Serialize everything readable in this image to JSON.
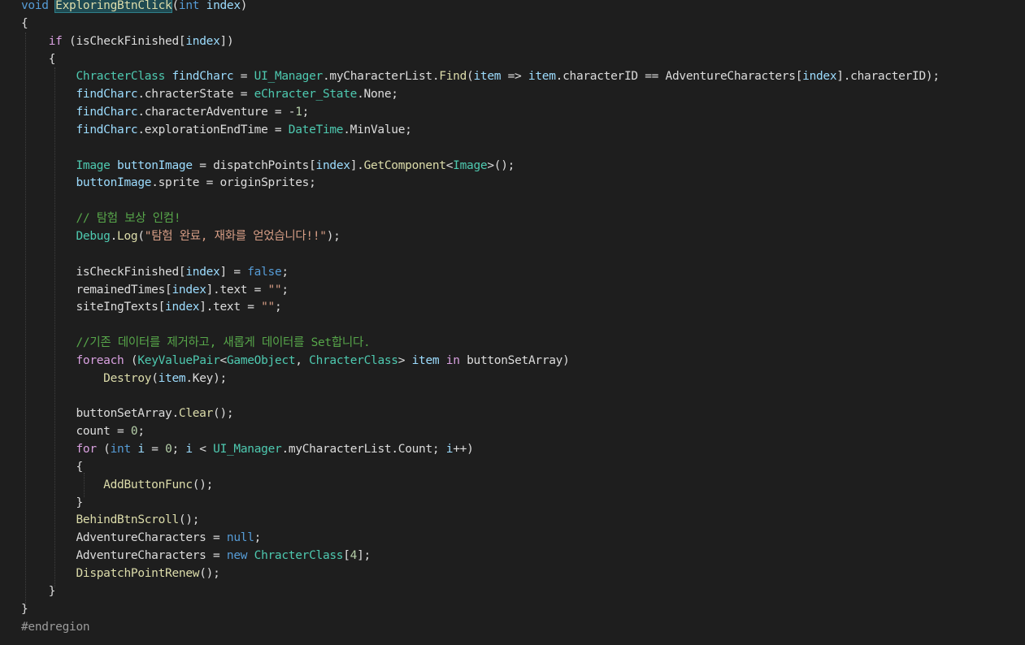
{
  "editor": {
    "lines": [
      [
        {
          "t": "void ",
          "c": "kw"
        },
        {
          "t": "ExploringBtnClick",
          "c": "method hl"
        },
        {
          "t": "(",
          "c": ""
        },
        {
          "t": "int ",
          "c": "kw"
        },
        {
          "t": "index",
          "c": "param"
        },
        {
          "t": ")",
          "c": ""
        }
      ],
      [
        {
          "t": "{",
          "c": ""
        }
      ],
      [
        {
          "t": "    ",
          "c": ""
        },
        {
          "t": "if",
          "c": "ctl"
        },
        {
          "t": " (isCheckFinished[",
          "c": ""
        },
        {
          "t": "index",
          "c": "param"
        },
        {
          "t": "])",
          "c": ""
        }
      ],
      [
        {
          "t": "    {",
          "c": ""
        }
      ],
      [
        {
          "t": "        ",
          "c": ""
        },
        {
          "t": "ChracterClass",
          "c": "type"
        },
        {
          "t": " ",
          "c": ""
        },
        {
          "t": "findCharc",
          "c": "local"
        },
        {
          "t": " = ",
          "c": ""
        },
        {
          "t": "UI_Manager",
          "c": "type"
        },
        {
          "t": ".myCharacterList.",
          "c": ""
        },
        {
          "t": "Find",
          "c": "method"
        },
        {
          "t": "(",
          "c": ""
        },
        {
          "t": "item",
          "c": "local"
        },
        {
          "t": " => ",
          "c": ""
        },
        {
          "t": "item",
          "c": "local"
        },
        {
          "t": ".characterID == AdventureCharacters[",
          "c": ""
        },
        {
          "t": "index",
          "c": "param"
        },
        {
          "t": "].characterID);",
          "c": ""
        }
      ],
      [
        {
          "t": "        ",
          "c": ""
        },
        {
          "t": "findCharc",
          "c": "local"
        },
        {
          "t": ".chracterState = ",
          "c": ""
        },
        {
          "t": "eChracter_State",
          "c": "type"
        },
        {
          "t": ".None;",
          "c": ""
        }
      ],
      [
        {
          "t": "        ",
          "c": ""
        },
        {
          "t": "findCharc",
          "c": "local"
        },
        {
          "t": ".characterAdventure = -",
          "c": ""
        },
        {
          "t": "1",
          "c": "num"
        },
        {
          "t": ";",
          "c": ""
        }
      ],
      [
        {
          "t": "        ",
          "c": ""
        },
        {
          "t": "findCharc",
          "c": "local"
        },
        {
          "t": ".explorationEndTime = ",
          "c": ""
        },
        {
          "t": "DateTime",
          "c": "type"
        },
        {
          "t": ".MinValue;",
          "c": ""
        }
      ],
      [
        {
          "t": "",
          "c": ""
        }
      ],
      [
        {
          "t": "        ",
          "c": ""
        },
        {
          "t": "Image",
          "c": "type"
        },
        {
          "t": " ",
          "c": ""
        },
        {
          "t": "buttonImage",
          "c": "local"
        },
        {
          "t": " = dispatchPoints[",
          "c": ""
        },
        {
          "t": "index",
          "c": "param"
        },
        {
          "t": "].",
          "c": ""
        },
        {
          "t": "GetComponent",
          "c": "method"
        },
        {
          "t": "<",
          "c": ""
        },
        {
          "t": "Image",
          "c": "type"
        },
        {
          "t": ">();",
          "c": ""
        }
      ],
      [
        {
          "t": "        ",
          "c": ""
        },
        {
          "t": "buttonImage",
          "c": "local"
        },
        {
          "t": ".sprite = originSprites;",
          "c": ""
        }
      ],
      [
        {
          "t": "",
          "c": ""
        }
      ],
      [
        {
          "t": "        ",
          "c": ""
        },
        {
          "t": "// 탐험 보상 인컴!",
          "c": "cmt"
        }
      ],
      [
        {
          "t": "        ",
          "c": ""
        },
        {
          "t": "Debug",
          "c": "type"
        },
        {
          "t": ".",
          "c": ""
        },
        {
          "t": "Log",
          "c": "method"
        },
        {
          "t": "(",
          "c": ""
        },
        {
          "t": "\"탐험 완료, 재화를 얻었습니다!!\"",
          "c": "str"
        },
        {
          "t": ");",
          "c": ""
        }
      ],
      [
        {
          "t": "",
          "c": ""
        }
      ],
      [
        {
          "t": "        isCheckFinished[",
          "c": ""
        },
        {
          "t": "index",
          "c": "param"
        },
        {
          "t": "] = ",
          "c": ""
        },
        {
          "t": "false",
          "c": "kw"
        },
        {
          "t": ";",
          "c": ""
        }
      ],
      [
        {
          "t": "        remainedTimes[",
          "c": ""
        },
        {
          "t": "index",
          "c": "param"
        },
        {
          "t": "].text = ",
          "c": ""
        },
        {
          "t": "\"\"",
          "c": "str"
        },
        {
          "t": ";",
          "c": ""
        }
      ],
      [
        {
          "t": "        siteIngTexts[",
          "c": ""
        },
        {
          "t": "index",
          "c": "param"
        },
        {
          "t": "].text = ",
          "c": ""
        },
        {
          "t": "\"\"",
          "c": "str"
        },
        {
          "t": ";",
          "c": ""
        }
      ],
      [
        {
          "t": "",
          "c": ""
        }
      ],
      [
        {
          "t": "        ",
          "c": ""
        },
        {
          "t": "//기존 데이터를 제거하고, 새롭게 데이터를 Set합니다.",
          "c": "cmt"
        }
      ],
      [
        {
          "t": "        ",
          "c": ""
        },
        {
          "t": "foreach",
          "c": "ctl"
        },
        {
          "t": " (",
          "c": ""
        },
        {
          "t": "KeyValuePair",
          "c": "type"
        },
        {
          "t": "<",
          "c": ""
        },
        {
          "t": "GameObject",
          "c": "type"
        },
        {
          "t": ", ",
          "c": ""
        },
        {
          "t": "ChracterClass",
          "c": "type"
        },
        {
          "t": "> ",
          "c": ""
        },
        {
          "t": "item",
          "c": "local"
        },
        {
          "t": " ",
          "c": ""
        },
        {
          "t": "in",
          "c": "ctl"
        },
        {
          "t": " buttonSetArray)",
          "c": ""
        }
      ],
      [
        {
          "t": "            ",
          "c": ""
        },
        {
          "t": "Destroy",
          "c": "method"
        },
        {
          "t": "(",
          "c": ""
        },
        {
          "t": "item",
          "c": "local"
        },
        {
          "t": ".Key);",
          "c": ""
        }
      ],
      [
        {
          "t": "",
          "c": ""
        }
      ],
      [
        {
          "t": "        buttonSetArray.",
          "c": ""
        },
        {
          "t": "Clear",
          "c": "method"
        },
        {
          "t": "();",
          "c": ""
        }
      ],
      [
        {
          "t": "        count = ",
          "c": ""
        },
        {
          "t": "0",
          "c": "num"
        },
        {
          "t": ";",
          "c": ""
        }
      ],
      [
        {
          "t": "        ",
          "c": ""
        },
        {
          "t": "for",
          "c": "ctl"
        },
        {
          "t": " (",
          "c": ""
        },
        {
          "t": "int",
          "c": "kw"
        },
        {
          "t": " ",
          "c": ""
        },
        {
          "t": "i",
          "c": "local"
        },
        {
          "t": " = ",
          "c": ""
        },
        {
          "t": "0",
          "c": "num"
        },
        {
          "t": "; ",
          "c": ""
        },
        {
          "t": "i",
          "c": "local"
        },
        {
          "t": " < ",
          "c": ""
        },
        {
          "t": "UI_Manager",
          "c": "type"
        },
        {
          "t": ".myCharacterList.Count; ",
          "c": ""
        },
        {
          "t": "i",
          "c": "local"
        },
        {
          "t": "++)",
          "c": ""
        }
      ],
      [
        {
          "t": "        {",
          "c": ""
        }
      ],
      [
        {
          "t": "            ",
          "c": ""
        },
        {
          "t": "AddButtonFunc",
          "c": "method"
        },
        {
          "t": "();",
          "c": ""
        }
      ],
      [
        {
          "t": "        }",
          "c": ""
        }
      ],
      [
        {
          "t": "        ",
          "c": ""
        },
        {
          "t": "BehindBtnScroll",
          "c": "method"
        },
        {
          "t": "();",
          "c": ""
        }
      ],
      [
        {
          "t": "        AdventureCharacters = ",
          "c": ""
        },
        {
          "t": "null",
          "c": "kw"
        },
        {
          "t": ";",
          "c": ""
        }
      ],
      [
        {
          "t": "        AdventureCharacters = ",
          "c": ""
        },
        {
          "t": "new",
          "c": "kw"
        },
        {
          "t": " ",
          "c": ""
        },
        {
          "t": "ChracterClass",
          "c": "type"
        },
        {
          "t": "[",
          "c": ""
        },
        {
          "t": "4",
          "c": "num"
        },
        {
          "t": "];",
          "c": ""
        }
      ],
      [
        {
          "t": "        ",
          "c": ""
        },
        {
          "t": "DispatchPointRenew",
          "c": "method"
        },
        {
          "t": "();",
          "c": ""
        }
      ],
      [
        {
          "t": "    }",
          "c": ""
        }
      ],
      [
        {
          "t": "}",
          "c": ""
        }
      ],
      [
        {
          "t": "#endregion",
          "c": "pre"
        }
      ]
    ]
  }
}
